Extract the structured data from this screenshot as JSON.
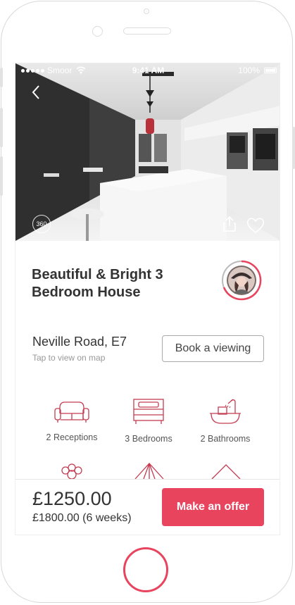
{
  "status_bar": {
    "carrier": "Smoor",
    "time": "9:41 AM",
    "battery": "100%"
  },
  "hero": {
    "badge_360": "360"
  },
  "listing": {
    "title_line1": "Beautiful & Bright 3",
    "title_line2": "Bedroom House",
    "address": "Neville Road, E7",
    "map_hint": "Tap to view on map",
    "book_label": "Book a viewing"
  },
  "features": [
    {
      "label": "2 Receptions",
      "icon": "sofa-icon"
    },
    {
      "label": "3 Bedrooms",
      "icon": "bed-icon"
    },
    {
      "label": "2 Bathrooms",
      "icon": "bathtub-icon"
    }
  ],
  "footer": {
    "price": "£1250.00",
    "price_sub": "£1800.00 (6 weeks)",
    "offer_label": "Make an offer"
  },
  "colors": {
    "accent": "#e8445e",
    "text": "#333333",
    "muted": "#999999"
  }
}
